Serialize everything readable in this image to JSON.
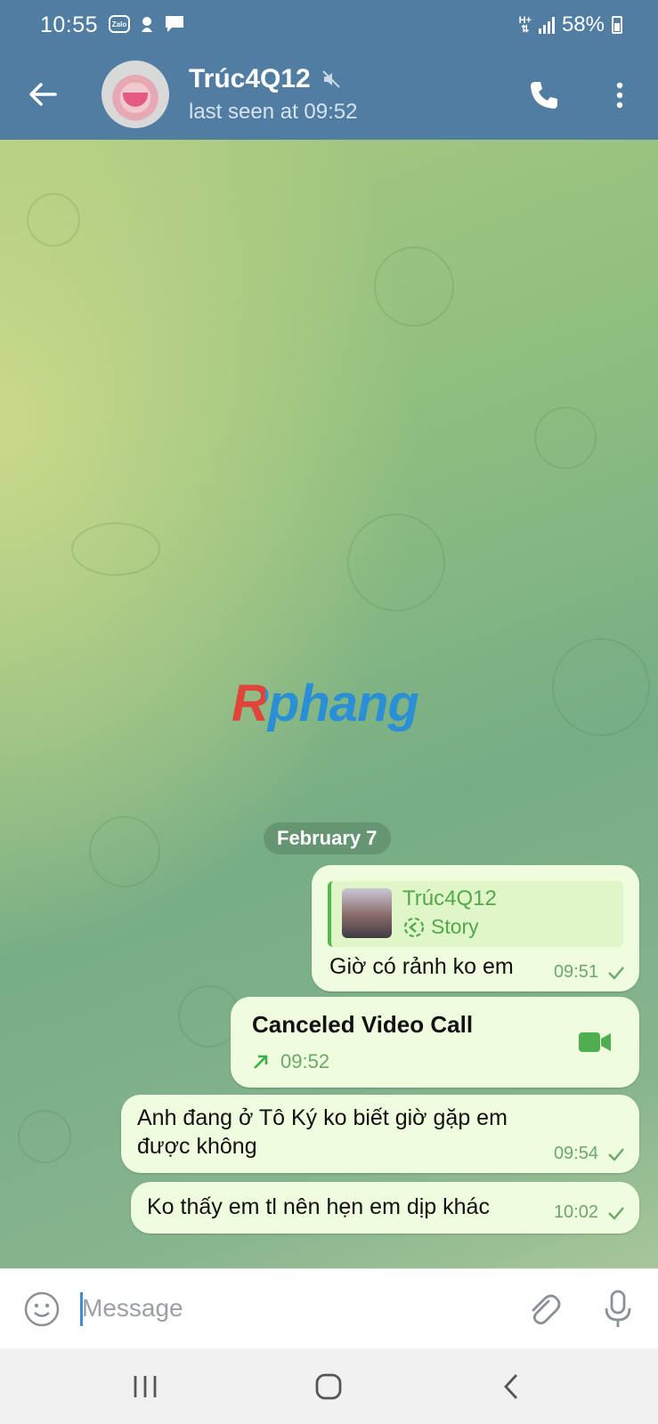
{
  "status_bar": {
    "time": "10:55",
    "notification_icons": [
      "zalo-icon",
      "messenger-bubble-icon",
      "chat-icon"
    ],
    "network": "H+",
    "battery": "58%"
  },
  "header": {
    "contact_name": "Trúc4Q12",
    "last_seen": "last seen at 09:52",
    "muted": true,
    "color": "#517da2"
  },
  "watermark": "Rphang",
  "date_separator": "February 7",
  "messages": [
    {
      "type": "reply-story",
      "reply_name": "Trúc4Q12",
      "reply_label": "Story",
      "text": "Giờ có rảnh ko em",
      "time": "09:51"
    },
    {
      "type": "call",
      "title": "Canceled Video Call",
      "time": "09:52"
    },
    {
      "type": "text",
      "text": "Anh đang ở Tô Ký ko biết giờ gặp em được không",
      "time": "09:54"
    },
    {
      "type": "text",
      "text": "Ko thấy em tl nên hẹn em dịp khác",
      "time": "10:02"
    }
  ],
  "input": {
    "placeholder": "Message"
  },
  "colors": {
    "bubble_out": "#effdde",
    "accent_green": "#54b84a",
    "caret_blue": "#3d8fd4"
  }
}
